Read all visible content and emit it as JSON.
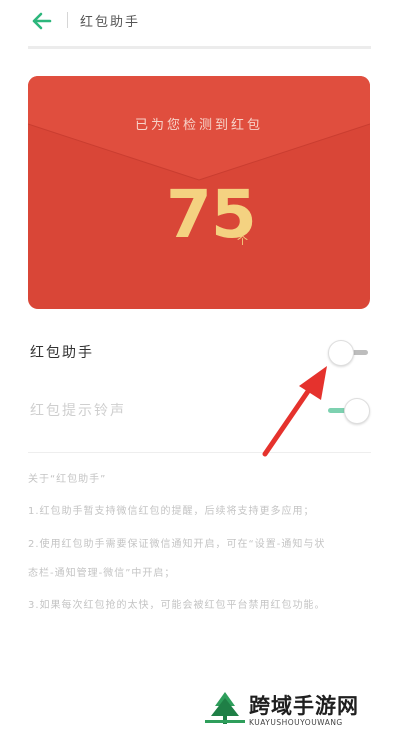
{
  "header": {
    "title": "红包助手",
    "back_icon": "arrow-left-icon",
    "accent": "#2db67c"
  },
  "envelope": {
    "caption": "已为您检测到红包",
    "count": "75",
    "unit": "个",
    "color": "#d94637",
    "count_color": "#f4d281"
  },
  "settings": [
    {
      "label": "红包助手",
      "enabled": false
    },
    {
      "label": "红包提示铃声",
      "enabled": true
    }
  ],
  "about": {
    "title": "关于“红包助手”",
    "line1": "1.红包助手暂支持微信红包的提醒，后续将支持更多应用；",
    "line2a": "2.使用红包助手需要保证微信通知开启，可在“设置-通知与状",
    "line2b": "态栏-通知管理-微信”中开启；",
    "line3": "3.如果每次红包抢的太快，可能会被红包平台禁用红包功能。"
  },
  "annotation": {
    "icon": "red-arrow-icon",
    "color": "#e5322d"
  },
  "watermark": {
    "title": "跨域手游网",
    "subtitle": "KUAYUSHOUYOUWANG"
  }
}
